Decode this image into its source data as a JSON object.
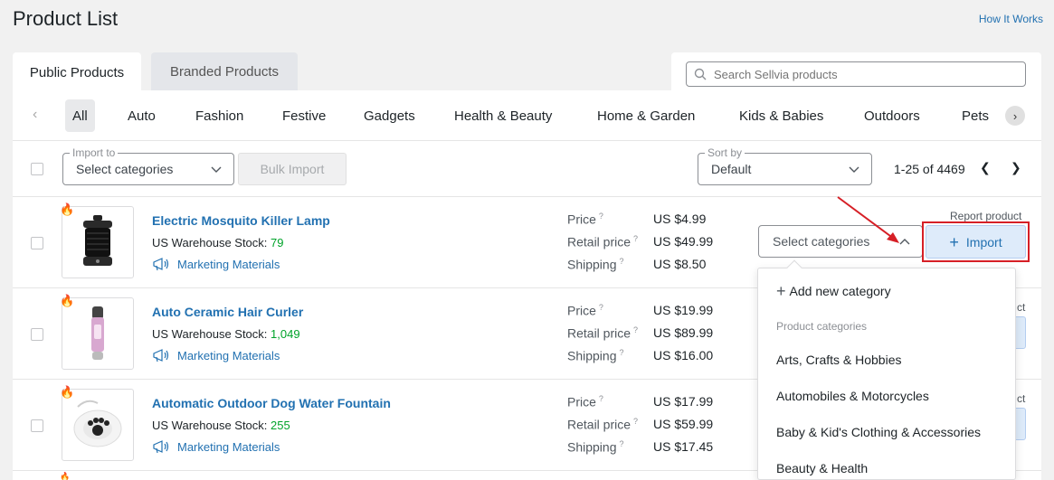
{
  "header": {
    "title": "Product List",
    "how_link": "How It Works"
  },
  "tabs": [
    {
      "label": "Public Products",
      "active": true
    },
    {
      "label": "Branded Products",
      "active": false
    }
  ],
  "search": {
    "placeholder": "Search Sellvia products"
  },
  "categories": [
    "All",
    "Auto",
    "Fashion",
    "Festive",
    "Gadgets",
    "Health & Beauty",
    "Home & Garden",
    "Kids & Babies",
    "Outdoors",
    "Pets"
  ],
  "toolbar": {
    "import_to_legend": "Import to",
    "import_to_value": "Select categories",
    "bulk_import_label": "Bulk Import",
    "sort_legend": "Sort by",
    "sort_value": "Default",
    "pagination": "1-25 of 4469"
  },
  "labels": {
    "warehouse": "US Warehouse Stock:",
    "marketing": "Marketing Materials",
    "price": "Price",
    "retail": "Retail price",
    "shipping": "Shipping",
    "help": "?",
    "report": "Report product",
    "report_clip": "ct",
    "select_categories": "Select categories",
    "import": "Import"
  },
  "products": [
    {
      "name": "Electric Mosquito Killer Lamp",
      "stock": "79",
      "price": "US $4.99",
      "retail": "US $49.99",
      "shipping": "US $8.50"
    },
    {
      "name": "Auto Ceramic Hair Curler",
      "stock": "1,049",
      "price": "US $19.99",
      "retail": "US $89.99",
      "shipping": "US $16.00"
    },
    {
      "name": "Automatic Outdoor Dog Water Fountain",
      "stock": "255",
      "price": "US $17.99",
      "retail": "US $59.99",
      "shipping": "US $17.45"
    }
  ],
  "dropdown": {
    "add_label": "Add new category",
    "heading": "Product categories",
    "items": [
      "Arts, Crafts & Hobbies",
      "Automobiles & Motorcycles",
      "Baby & Kid's Clothing & Accessories",
      "Beauty & Health"
    ]
  },
  "colors": {
    "link": "#2271b1",
    "stock": "#00a32a",
    "highlight": "#d61f26",
    "import_bg": "#deebfa"
  }
}
